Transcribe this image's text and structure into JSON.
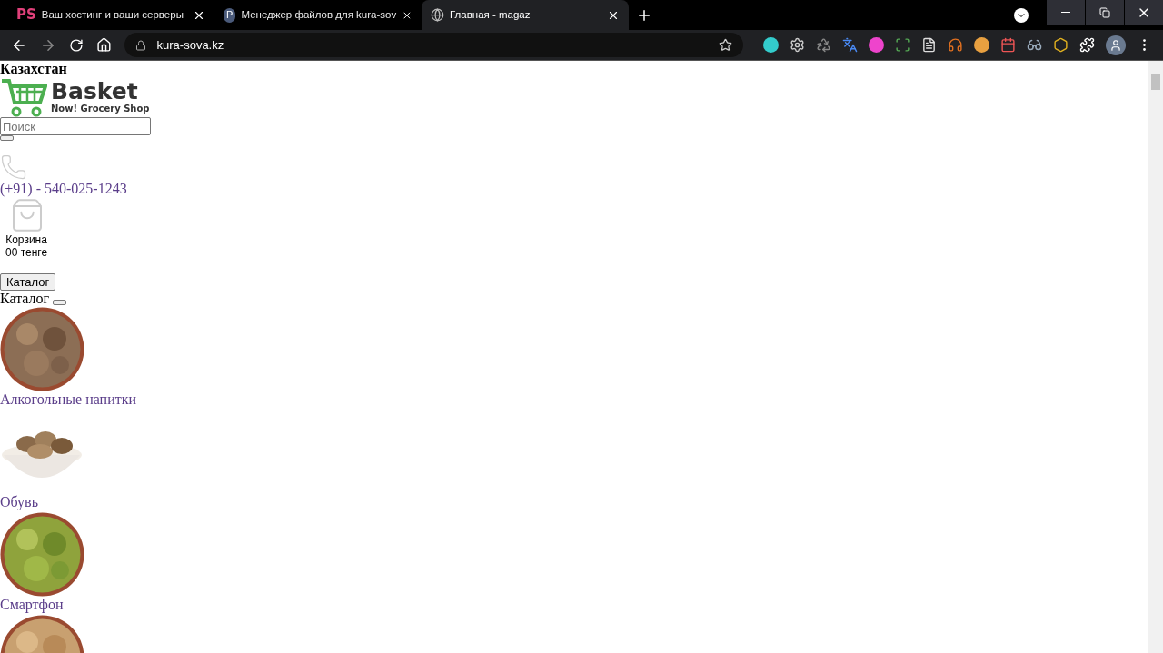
{
  "tabs": [
    {
      "title": "Ваш хостинг и ваши серверы",
      "favicon": "PS",
      "kind": "text",
      "selected": false
    },
    {
      "title": "Менеджер файлов для kura-sov",
      "favicon": "P",
      "kind": "round",
      "selected": false
    },
    {
      "title": "Главная - magaz",
      "kind": "globe",
      "selected": true
    }
  ],
  "address_bar": {
    "url": "kura-sova.kz"
  },
  "page": {
    "region": "Казахстан",
    "logo": {
      "name": "Basket",
      "tagline": "Now! Grocery Shop"
    },
    "search": {
      "placeholder": "Поиск"
    },
    "phone": "(+91) - 540-025-1243",
    "cart": {
      "label": "Корзина",
      "total": "00 тенге"
    },
    "catalog_button": "Каталог",
    "catalog_heading": "Каталог",
    "categories": [
      {
        "name": "Алкогольные напитки",
        "kind": "seeds"
      },
      {
        "name": "Обувь",
        "kind": "bowl"
      },
      {
        "name": "Смартфон",
        "kind": "pods"
      },
      {
        "kind": "root"
      }
    ]
  }
}
